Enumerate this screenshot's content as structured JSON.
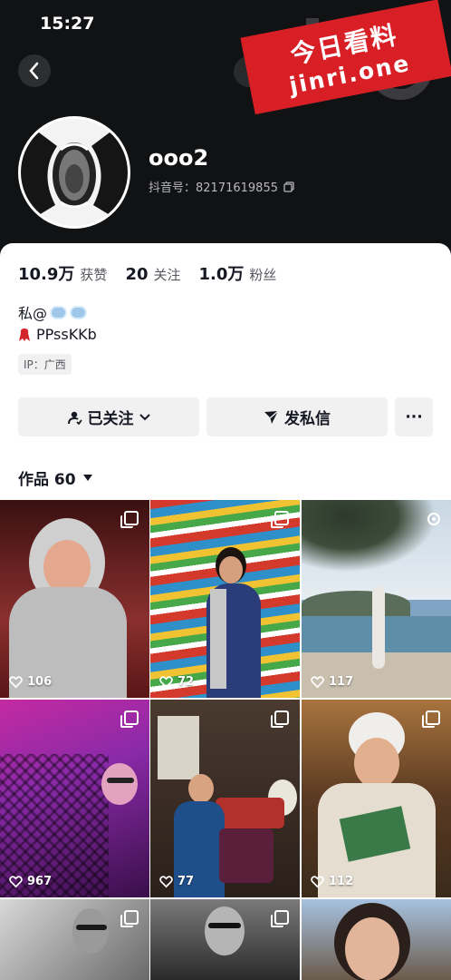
{
  "status_bar": {
    "time": "15:27"
  },
  "watermark": {
    "title": "今日看料",
    "url": "jinri.one"
  },
  "profile": {
    "nickname": "ooo2",
    "douyin_id": "抖音号：82171619855",
    "stats": [
      {
        "num": "10.9万",
        "label": "获赞"
      },
      {
        "num": "20",
        "label": "关注"
      },
      {
        "num": "1.0万",
        "label": "粉丝"
      }
    ],
    "bio_line1": "私@",
    "bio_line2": "PPssKKb",
    "ip": "IP：广西"
  },
  "buttons": {
    "follow": "已关注",
    "message": "发私信",
    "more": "···"
  },
  "tabs": {
    "works": "作品 60"
  },
  "icons": {
    "back": "chevron-left-icon",
    "copy": "copy-icon",
    "person": "person-check-icon",
    "chevron": "chevron-down-icon",
    "send": "send-icon",
    "heart": "heart-outline-icon",
    "multi": "multi-image-icon",
    "bubble": "cloud-bubble-icon",
    "ribbon": "ribbon-icon"
  },
  "colors": {
    "header_bg": "#111214",
    "watermark_red": "#d81f26",
    "button_bg": "#f1f1f2",
    "text": "#161823"
  },
  "posts": [
    {
      "likes": "106"
    },
    {
      "likes": "72"
    },
    {
      "likes": "117"
    },
    {
      "likes": "967"
    },
    {
      "likes": "77"
    },
    {
      "likes": "112"
    },
    {
      "likes": ""
    },
    {
      "likes": ""
    },
    {
      "likes": ""
    }
  ]
}
